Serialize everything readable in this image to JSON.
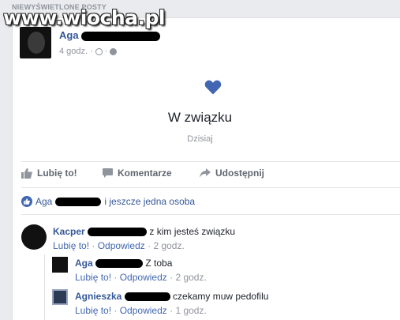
{
  "section": {
    "label": "NIEWYŚWIETLONE POSTY"
  },
  "watermark": "www.wiocha.pl",
  "post": {
    "author": "Aga",
    "time": "4 godz.",
    "status_title": "W związku",
    "status_date": "Dzisiaj",
    "heart_color": "#4267b2"
  },
  "actions": {
    "like": "Lubię to!",
    "comment": "Komentarze",
    "share": "Udostępnij"
  },
  "likes": {
    "name": "Aga",
    "rest": "i jeszcze jedna osoba"
  },
  "comments": [
    {
      "author": "Kacper",
      "text": "z kim jesteś związku",
      "like": "Lubię to!",
      "reply": "Odpowiedz",
      "time": "2 godz."
    },
    {
      "author": "Aga",
      "text": "Z toba",
      "like": "Lubię to!",
      "reply": "Odpowiedz",
      "time": "2 godz."
    },
    {
      "author": "Agnieszka",
      "text": "czekamy muw pedofilu",
      "like": "Lubię to!",
      "reply": "Odpowiedz",
      "time": "1 godz."
    }
  ]
}
